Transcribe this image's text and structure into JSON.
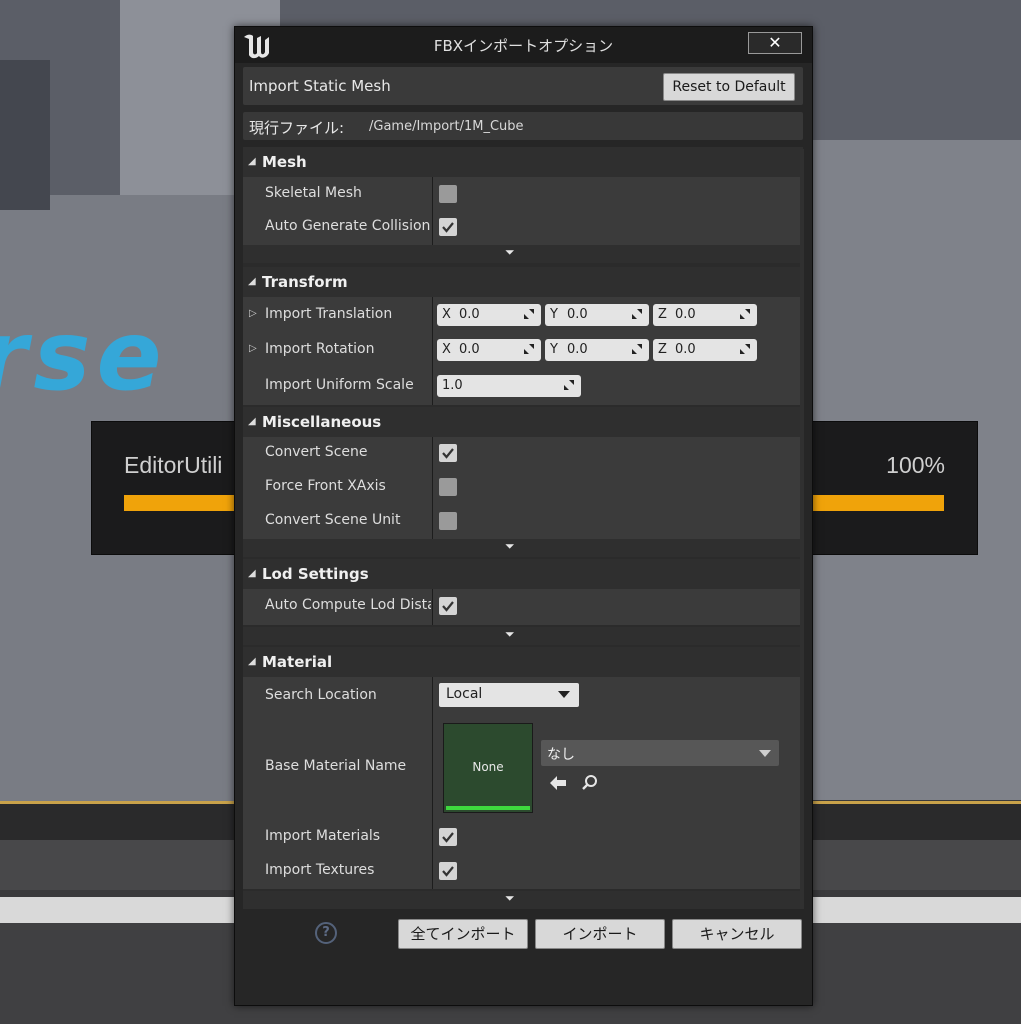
{
  "background": {
    "logo_text": "rse",
    "progress": {
      "label": "EditorUtili",
      "percent_text": "100%",
      "fraction": 1.0
    }
  },
  "dialog": {
    "title": "FBXインポートオプション",
    "close_label": "✕",
    "header": {
      "label": "Import Static Mesh",
      "reset_label": "Reset to Default"
    },
    "current_file": {
      "key": "現行ファイル:",
      "value": "/Game/Import/1M_Cube"
    },
    "sections": {
      "mesh": {
        "title": "Mesh",
        "skeletal_mesh": {
          "label": "Skeletal Mesh",
          "checked": false
        },
        "auto_generate_collision": {
          "label": "Auto Generate Collision",
          "checked": true
        }
      },
      "transform": {
        "title": "Transform",
        "import_translation": {
          "label": "Import Translation",
          "x": "0.0",
          "y": "0.0",
          "z": "0.0"
        },
        "import_rotation": {
          "label": "Import Rotation",
          "x": "0.0",
          "y": "0.0",
          "z": "0.0"
        },
        "import_uniform_scale": {
          "label": "Import Uniform Scale",
          "value": "1.0"
        },
        "axis": {
          "x": "X",
          "y": "Y",
          "z": "Z"
        }
      },
      "misc": {
        "title": "Miscellaneous",
        "convert_scene": {
          "label": "Convert Scene",
          "checked": true
        },
        "force_front_xaxis": {
          "label": "Force Front XAxis",
          "checked": false
        },
        "convert_scene_unit": {
          "label": "Convert Scene Unit",
          "checked": false
        }
      },
      "lod": {
        "title": "Lod Settings",
        "auto_compute": {
          "label": "Auto Compute Lod Distances",
          "checked": true
        }
      },
      "material": {
        "title": "Material",
        "search_location": {
          "label": "Search Location",
          "value": "Local"
        },
        "base_material_name": {
          "label": "Base Material Name",
          "thumb_text": "None",
          "asset_value": "なし"
        },
        "import_materials": {
          "label": "Import Materials",
          "checked": true
        },
        "import_textures": {
          "label": "Import Textures",
          "checked": true
        }
      }
    },
    "footer": {
      "help_label": "?",
      "import_all": "全てインポート",
      "import": "インポート",
      "cancel": "キャンセル"
    }
  },
  "colors": {
    "accent_progress": "#f0a30a",
    "thumb_bg": "#2c4a2e",
    "thumb_bar": "#3ed83e"
  }
}
